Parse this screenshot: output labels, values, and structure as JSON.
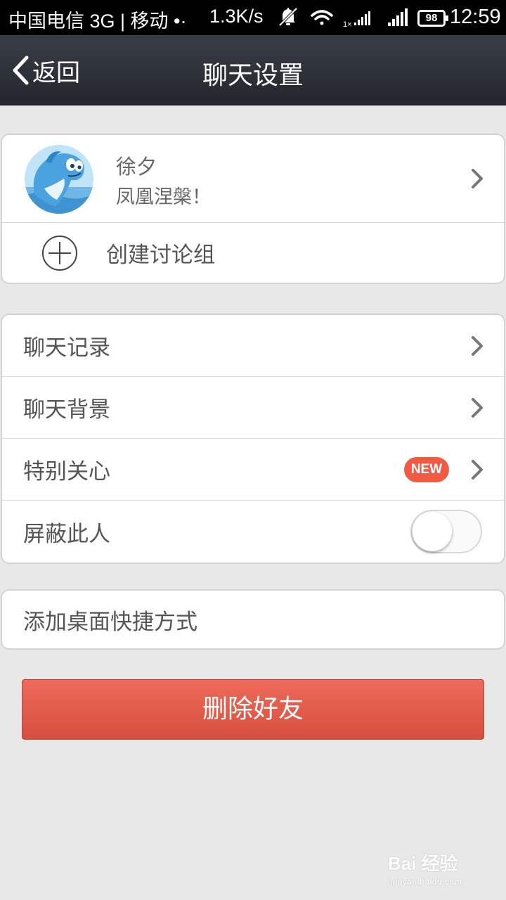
{
  "status_bar": {
    "carrier": "中国电信 3G | 移动 •·",
    "speed": "1.3K/s",
    "battery": "98",
    "time": "12:59"
  },
  "header": {
    "back_label": "返回",
    "title": "聊天设置"
  },
  "profile": {
    "name": "徐夕",
    "signature": "凤凰涅槃！"
  },
  "create_group": {
    "label": "创建讨论组"
  },
  "settings": {
    "items": [
      {
        "label": "聊天记录"
      },
      {
        "label": "聊天背景"
      },
      {
        "label": "特别关心",
        "badge": "NEW"
      },
      {
        "label": "屏蔽此人",
        "toggle": false
      }
    ]
  },
  "shortcut": {
    "label": "添加桌面快捷方式"
  },
  "delete_button": {
    "label": "删除好友"
  },
  "watermark": {
    "main": "Bai 经验",
    "sub": "jingyan.baidu.com"
  },
  "colors": {
    "title_bar": "#2d3037",
    "badge": "#f25a43",
    "delete": "#e05a48",
    "background": "#e8e8e8"
  },
  "icons": {
    "back": "chevron-left-icon",
    "row_arrow": "chevron-right-icon",
    "create": "plus-circle-icon",
    "silent": "bell-off-icon",
    "wifi": "wifi-icon",
    "signal": "signal-icon"
  }
}
